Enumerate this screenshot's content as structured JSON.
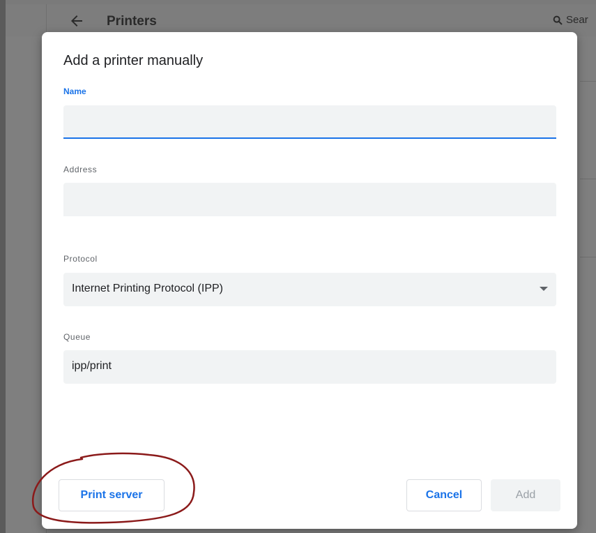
{
  "background": {
    "page_title": "Printers",
    "search_text": "Sear"
  },
  "dialog": {
    "title": "Add a printer manually",
    "name": {
      "label": "Name",
      "value": ""
    },
    "address": {
      "label": "Address",
      "value": ""
    },
    "protocol": {
      "label": "Protocol",
      "value": "Internet Printing Protocol (IPP)"
    },
    "queue": {
      "label": "Queue",
      "value": "ipp/print"
    },
    "buttons": {
      "print_server": "Print server",
      "cancel": "Cancel",
      "add": "Add"
    }
  },
  "colors": {
    "accent": "#1a73e8",
    "annotation": "#8b1a1a"
  }
}
